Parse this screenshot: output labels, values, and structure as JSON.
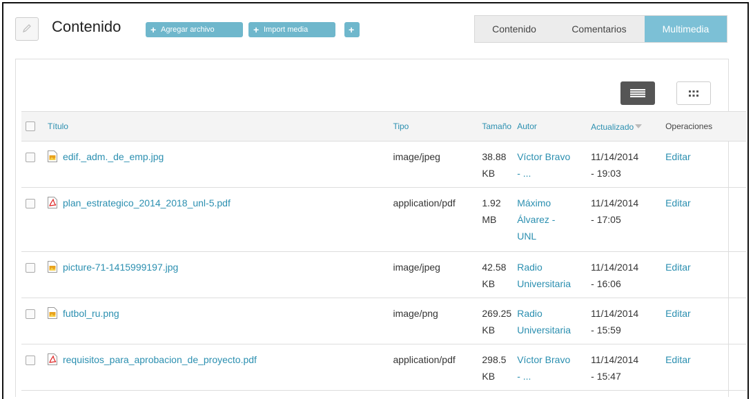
{
  "header": {
    "title": "Contenido",
    "add_file_label": "Agregar archivo",
    "import_media_label": "Import media",
    "add_label": ""
  },
  "tabs": [
    {
      "label": "Contenido",
      "active": false
    },
    {
      "label": "Comentarios",
      "active": false
    },
    {
      "label": "Multimedia",
      "active": true
    }
  ],
  "table": {
    "columns": {
      "title": "Título",
      "type": "Tipo",
      "size": "Tamaño",
      "author": "Autor",
      "updated": "Actualizado",
      "operations": "Operaciones"
    },
    "rows": [
      {
        "file_type": "image",
        "title": "edif._adm._de_emp.jpg",
        "type": "image/jpeg",
        "size_value": "38.88",
        "size_unit": "KB",
        "author_line1": "Víctor Bravo",
        "author_line2": "- ...",
        "author_line3": "",
        "date": "11/14/2014",
        "time": "- 19:03",
        "op": "Editar"
      },
      {
        "file_type": "pdf",
        "title": "plan_estrategico_2014_2018_unl-5.pdf",
        "type": "application/pdf",
        "size_value": "1.92",
        "size_unit": "MB",
        "author_line1": "Máximo",
        "author_line2": "Álvarez -",
        "author_line3": "UNL",
        "date": "11/14/2014",
        "time": "- 17:05",
        "op": "Editar"
      },
      {
        "file_type": "image",
        "title": "picture-71-1415999197.jpg",
        "type": "image/jpeg",
        "size_value": "42.58",
        "size_unit": "KB",
        "author_line1": "Radio",
        "author_line2": "Universitaria",
        "author_line3": "",
        "date": "11/14/2014",
        "time": "- 16:06",
        "op": "Editar"
      },
      {
        "file_type": "image",
        "title": "futbol_ru.png",
        "type": "image/png",
        "size_value": "269.25",
        "size_unit": "KB",
        "author_line1": "Radio",
        "author_line2": "Universitaria",
        "author_line3": "",
        "date": "11/14/2014",
        "time": "- 15:59",
        "op": "Editar"
      },
      {
        "file_type": "pdf",
        "title": "requisitos_para_aprobacion_de_proyecto.pdf",
        "type": "application/pdf",
        "size_value": "298.5",
        "size_unit": "KB",
        "author_line1": "Víctor Bravo",
        "author_line2": "- ...",
        "author_line3": "",
        "date": "11/14/2014",
        "time": "- 15:47",
        "op": "Editar"
      }
    ]
  },
  "icons": {
    "edit": "pencil-icon",
    "plus": "plus-icon",
    "list_view": "list-view-icon",
    "grid_view": "grid-view-icon",
    "image_file": "image-file-icon",
    "pdf_file": "pdf-file-icon",
    "sort_desc": "sort-desc-icon"
  },
  "colors": {
    "accent": "#6fb7cc",
    "link": "#2b8fb0",
    "active_tab": "#7cc0d6"
  }
}
